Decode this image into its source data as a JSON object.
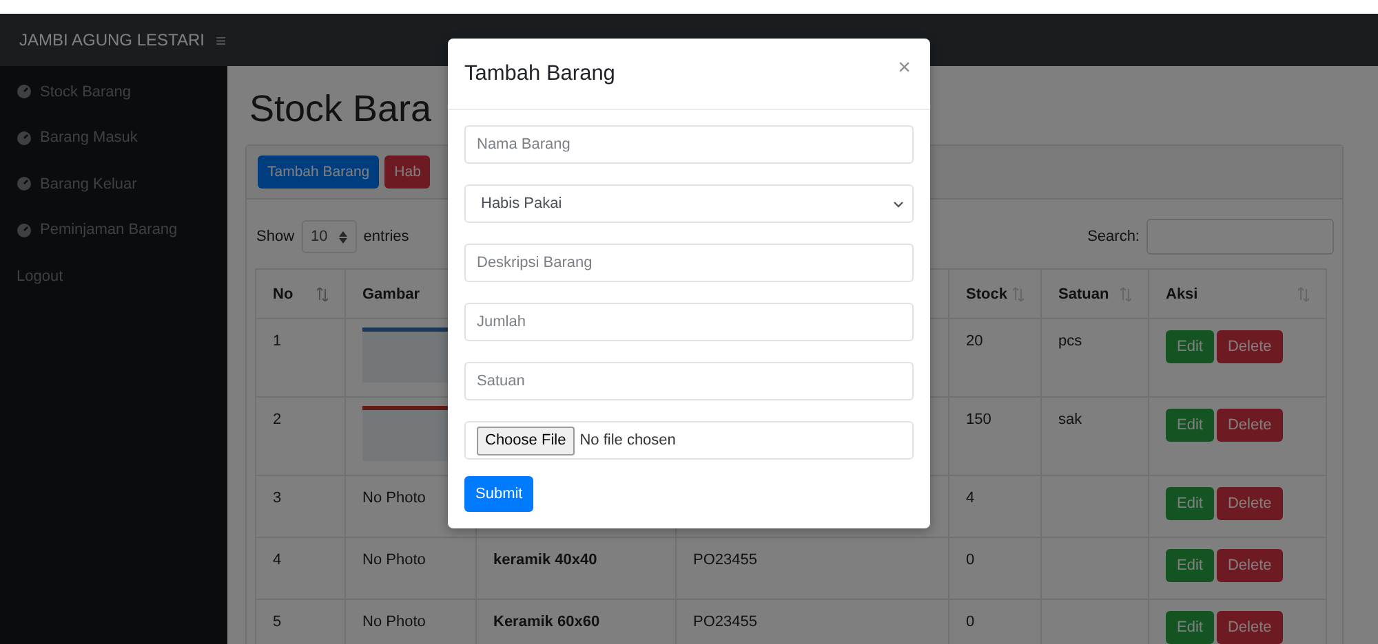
{
  "navbar": {
    "brand": "JAMBI AGUNG LESTARI",
    "menu_toggle": "≡"
  },
  "sidebar": {
    "items": [
      {
        "label": "Stock Barang",
        "kind": "icon"
      },
      {
        "label": "Barang Masuk",
        "kind": "icon"
      },
      {
        "label": "Barang Keluar",
        "kind": "icon"
      },
      {
        "label": "Peminjaman Barang",
        "kind": "icon"
      },
      {
        "label": "Logout",
        "kind": "plain"
      }
    ]
  },
  "page": {
    "title": "Stock Bara",
    "toolbar_buttons": [
      {
        "label": "Tambah Barang",
        "kind": "primary"
      },
      {
        "label": "Hab",
        "kind": "danger"
      }
    ],
    "length": {
      "before": "Show",
      "value": "10",
      "after": "entries"
    },
    "search": {
      "label": "Search:"
    },
    "table": {
      "columns": {
        "no": "No",
        "gambar": "Gambar",
        "stock": "Stock",
        "satuan": "Satuan",
        "aksi": "Aksi"
      },
      "rows": [
        {
          "no": "1",
          "gambar": {
            "kind": "image"
          },
          "stock": "20",
          "satuan": "pcs",
          "actions": [
            "Edit",
            "Delete"
          ]
        },
        {
          "no": "2",
          "gambar": {
            "kind": "image"
          },
          "stock": "150",
          "satuan": "sak",
          "actions": [
            "Edit",
            "Delete"
          ]
        },
        {
          "no": "3",
          "gambar": {
            "kind": "text",
            "text": "No Photo"
          },
          "stock": "4",
          "actions": [
            "Edit",
            "Delete"
          ]
        },
        {
          "no": "4",
          "gambar": {
            "kind": "text",
            "text": "No Photo"
          },
          "column_3": "keramik 40x40",
          "column_4": "PO23455",
          "stock": "0",
          "actions": [
            "Edit",
            "Delete"
          ]
        },
        {
          "no": "5",
          "gambar": {
            "kind": "text",
            "text": "No Photo"
          },
          "column_3": "Keramik 60x60",
          "column_4": "PO23455",
          "stock": "0",
          "actions": [
            "Edit",
            "Delete"
          ]
        }
      ]
    }
  },
  "modal": {
    "title": "Tambah Barang",
    "close": "×",
    "fields": [
      {
        "kind": "text",
        "placeholder": "Nama Barang"
      },
      {
        "kind": "select",
        "value": "Habis Pakai"
      },
      {
        "kind": "text",
        "placeholder": "Deskripsi Barang"
      },
      {
        "kind": "text",
        "placeholder": "Jumlah"
      },
      {
        "kind": "text",
        "placeholder": "Satuan"
      },
      {
        "kind": "file",
        "button": "Choose File",
        "status": "No file chosen"
      }
    ],
    "submit": "Submit"
  }
}
